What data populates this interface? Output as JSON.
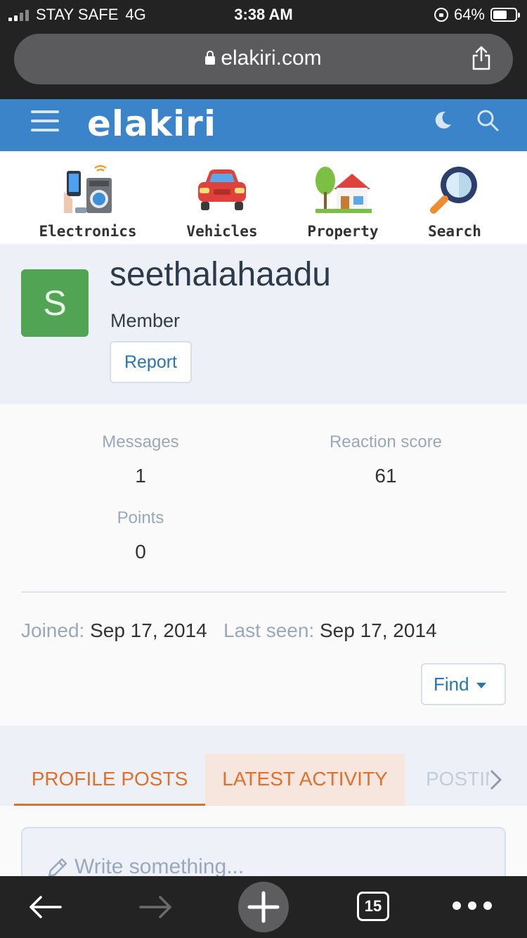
{
  "status_bar": {
    "carrier": "STAY SAFE",
    "network": "4G",
    "time": "3:38 AM",
    "battery": "64%",
    "battery_level": 0.64
  },
  "browser": {
    "url": "elakiri.com",
    "tabs_count": "15"
  },
  "site": {
    "logo": "elakiri",
    "accent_color": "#3b84c9"
  },
  "categories": [
    {
      "label": "Electronics",
      "icon": "electronics-icon"
    },
    {
      "label": "Vehicles",
      "icon": "car-icon"
    },
    {
      "label": "Property",
      "icon": "house-icon"
    },
    {
      "label": "Search",
      "icon": "magnifier-icon"
    }
  ],
  "profile": {
    "avatar_letter": "S",
    "avatar_color": "#51a454",
    "username": "seethalahaadu",
    "title": "Member",
    "report_label": "Report"
  },
  "stats": {
    "messages_label": "Messages",
    "messages_value": "1",
    "reaction_label": "Reaction score",
    "reaction_value": "61",
    "points_label": "Points",
    "points_value": "0"
  },
  "dates": {
    "joined_label": "Joined:",
    "joined_value": "Sep 17, 2014",
    "last_seen_label": "Last seen:",
    "last_seen_value": "Sep 17, 2014"
  },
  "find_label": "Find",
  "tabs": [
    {
      "label": "PROFILE POSTS",
      "active": true
    },
    {
      "label": "LATEST ACTIVITY",
      "active": false
    },
    {
      "label": "POSTINGS",
      "active": false
    }
  ],
  "composer": {
    "placeholder": "Write something..."
  }
}
